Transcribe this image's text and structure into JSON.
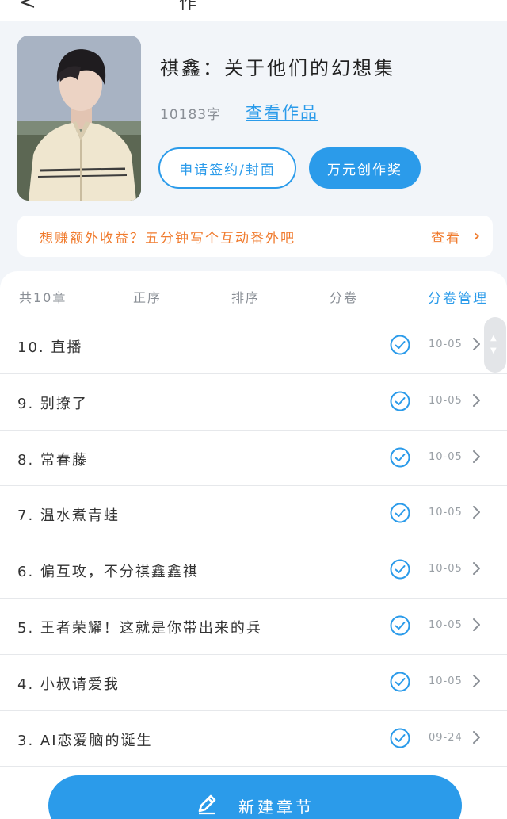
{
  "topbar": {
    "back_glyph": "<",
    "title_fragment": "作"
  },
  "book": {
    "title": "祺鑫：关于他们的幻想集",
    "word_count": "10183字",
    "view_work_label": "查看作品",
    "sign_button_label": "申请签约/封面",
    "award_button_label": "万元创作奖"
  },
  "promo": {
    "text": "想赚额外收益？五分钟写个互动番外吧",
    "link_label": "查看"
  },
  "tabs": {
    "count_label": "共10章",
    "order_label": "正序",
    "sort_label": "排序",
    "volume_label": "分卷",
    "volume_manage_label": "分卷管理"
  },
  "chapters": [
    {
      "title": "10. 直播",
      "date": "10-05"
    },
    {
      "title": "9. 别撩了",
      "date": "10-05"
    },
    {
      "title": "8. 常春藤",
      "date": "10-05"
    },
    {
      "title": "7. 温水煮青蛙",
      "date": "10-05"
    },
    {
      "title": "6. 偏互攻，不分祺鑫鑫祺",
      "date": "10-05"
    },
    {
      "title": "5. 王者荣耀！这就是你带出来的兵",
      "date": "10-05"
    },
    {
      "title": "4. 小叔请爱我",
      "date": "10-05"
    },
    {
      "title": "3. AI恋爱脑的诞生",
      "date": "09-24"
    }
  ],
  "new_chapter_label": "新建章节",
  "colors": {
    "accent": "#2b9bea",
    "promo": "#f07b2e"
  },
  "icons": [
    "check-circle-icon",
    "chevron-right-icon",
    "pencil-icon"
  ]
}
